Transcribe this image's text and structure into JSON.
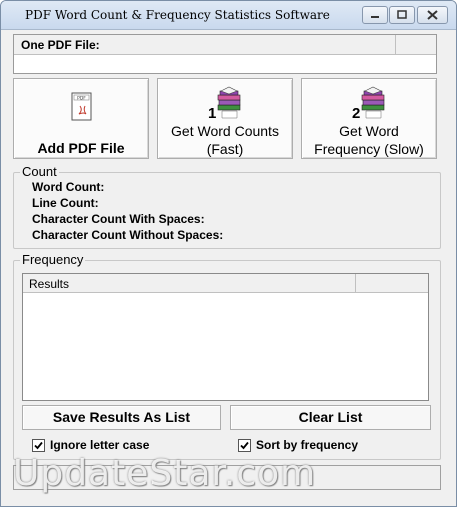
{
  "window": {
    "title": "PDF Word Count & Frequency Statistics Software",
    "buttons": [
      "minimize",
      "maximize",
      "close"
    ]
  },
  "file_panel": {
    "header_label": "One PDF File:",
    "value": ""
  },
  "actions": {
    "add_pdf": {
      "label": "Add PDF File",
      "icon": "pdf-document-icon"
    },
    "word_counts": {
      "label_line1": "Get Word Counts",
      "label_line2": "(Fast)",
      "step": "1",
      "icon": "books-icon"
    },
    "word_frequency": {
      "label_line1": "Get Word",
      "label_line2": "Frequency (Slow)",
      "step": "2",
      "icon": "books-icon"
    }
  },
  "count": {
    "title": "Count",
    "word_count": "Word Count:",
    "line_count": "Line Count:",
    "char_with_spaces": "Character Count With Spaces:",
    "char_without_spaces": "Character Count Without Spaces:"
  },
  "frequency": {
    "title": "Frequency",
    "results_header": "Results",
    "save_label": "Save Results As List",
    "clear_label": "Clear List",
    "ignore_case": {
      "label": "Ignore letter case",
      "checked": true
    },
    "sort_freq": {
      "label": "Sort by frequency",
      "checked": true
    }
  },
  "watermark": "UpdateStar.com",
  "colors": {
    "titlebar": "#c9d9ee",
    "window_bg": "#f0f0f0"
  }
}
